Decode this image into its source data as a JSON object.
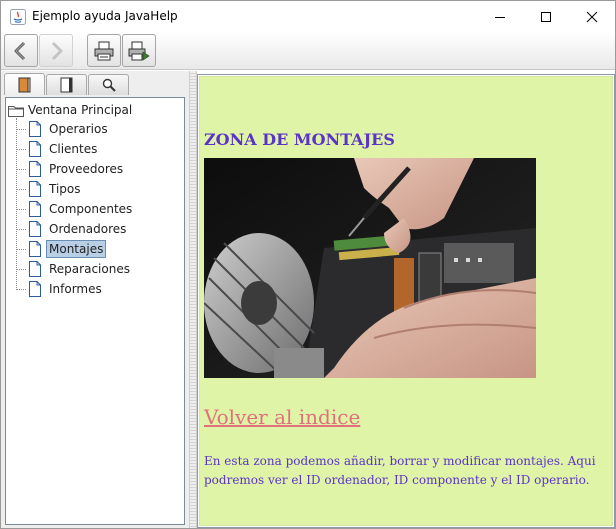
{
  "window": {
    "title": "Ejemplo ayuda JavaHelp"
  },
  "toolbar": {
    "back": "back-icon",
    "forward": "forward-icon",
    "print": "print-icon",
    "page_setup": "page-setup-icon"
  },
  "navigator": {
    "tabs": [
      {
        "icon": "toc-book-icon"
      },
      {
        "icon": "index-book-icon"
      },
      {
        "icon": "search-icon"
      }
    ],
    "root_label": "Ventana Principal",
    "items": [
      {
        "label": "Operarios"
      },
      {
        "label": "Clientes"
      },
      {
        "label": "Proveedores"
      },
      {
        "label": "Tipos"
      },
      {
        "label": "Componentes"
      },
      {
        "label": "Ordenadores"
      },
      {
        "label": "Montajes"
      },
      {
        "label": "Reparaciones"
      },
      {
        "label": "Informes"
      }
    ],
    "selected": "Montajes"
  },
  "content": {
    "heading": "ZONA DE MONTAJES",
    "back_link": "Volver al indice",
    "description": "En esta zona podemos añadir, borrar y modificar montajes. Aqui podremos ver el ID ordenador, ID componente y el ID operario.",
    "background_color": "#e0f4a8",
    "text_color": "#5a33c8",
    "link_color": "#e0707c"
  }
}
